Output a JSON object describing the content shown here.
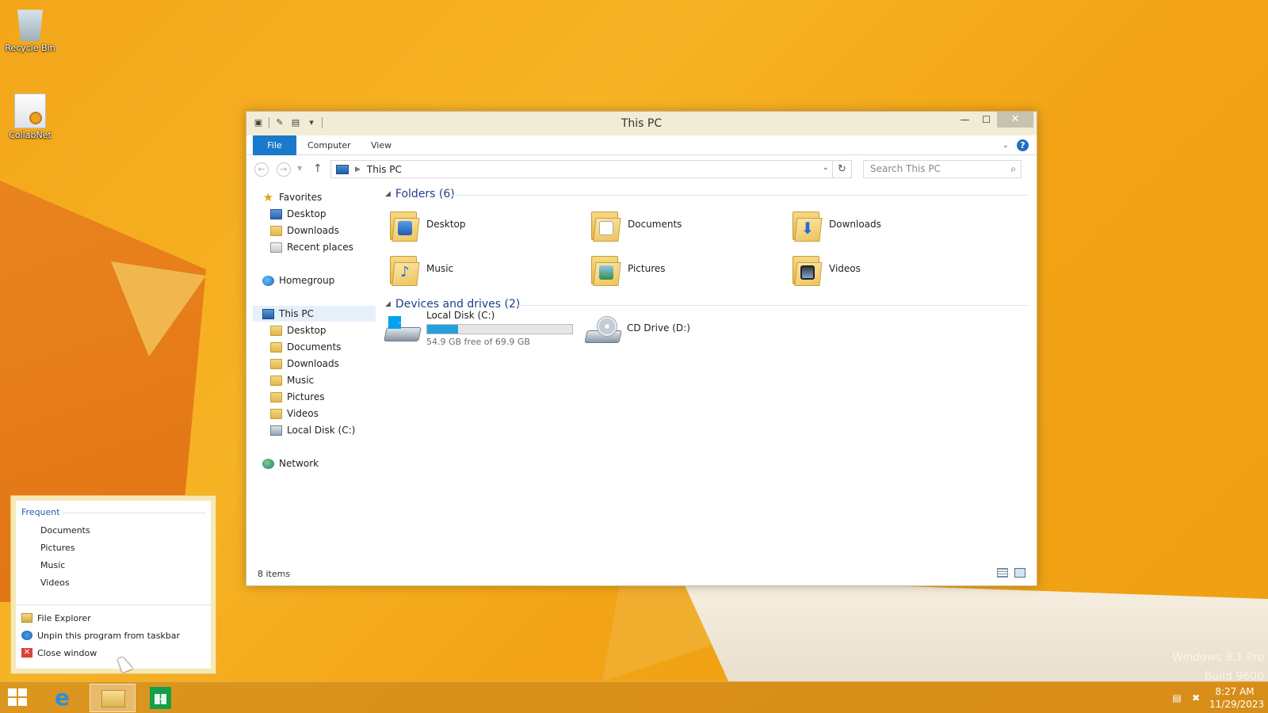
{
  "desktop": {
    "icons": [
      {
        "label": "Recycle Bin",
        "icon": "recycle-bin-icon"
      },
      {
        "label": "CollabNet",
        "icon": "certificate-icon"
      }
    ],
    "watermark": {
      "line1": "Windows 8.1 Pro",
      "line2": "Build 9600"
    }
  },
  "window": {
    "title": "This PC",
    "ribbon_tabs": {
      "file": "File",
      "computer": "Computer",
      "view": "View"
    },
    "help_label": "?",
    "address": {
      "path": "This PC"
    },
    "search": {
      "placeholder": "Search This PC"
    },
    "nav_pane": {
      "favorites": {
        "label": "Favorites",
        "items": [
          "Desktop",
          "Downloads",
          "Recent places"
        ]
      },
      "homegroup": "Homegroup",
      "this_pc": {
        "label": "This PC",
        "items": [
          "Desktop",
          "Documents",
          "Downloads",
          "Music",
          "Pictures",
          "Videos",
          "Local Disk (C:)"
        ]
      },
      "network": "Network"
    },
    "folders": {
      "header": "Folders (6)",
      "items": [
        {
          "name": "Desktop",
          "icon": "desktop-folder-icon"
        },
        {
          "name": "Documents",
          "icon": "documents-folder-icon"
        },
        {
          "name": "Downloads",
          "icon": "downloads-folder-icon"
        },
        {
          "name": "Music",
          "icon": "music-folder-icon"
        },
        {
          "name": "Pictures",
          "icon": "pictures-folder-icon"
        },
        {
          "name": "Videos",
          "icon": "videos-folder-icon"
        }
      ]
    },
    "devices": {
      "header": "Devices and drives (2)",
      "local_disk": {
        "name": "Local Disk (C:)",
        "free_text": "54.9 GB free of 69.9 GB",
        "used_fraction": 0.215
      },
      "cd_drive": {
        "name": "CD Drive (D:)"
      }
    },
    "status": {
      "items_count": "8 items"
    }
  },
  "jumplist": {
    "frequent_header": "Frequent",
    "frequent": [
      "Documents",
      "Pictures",
      "Music",
      "Videos"
    ],
    "tasks": {
      "file_explorer": "File Explorer",
      "unpin": "Unpin this program from taskbar",
      "close": "Close window"
    }
  },
  "taskbar": {
    "clock": {
      "time": "8:27 AM",
      "date": "11/29/2023"
    },
    "apps": [
      "internet-explorer",
      "file-explorer",
      "store"
    ]
  },
  "colors": {
    "accent": "#1979ca",
    "wallpaper": "#f4a61a",
    "progress": "#26a0da",
    "group_header": "#1e3f8a"
  }
}
